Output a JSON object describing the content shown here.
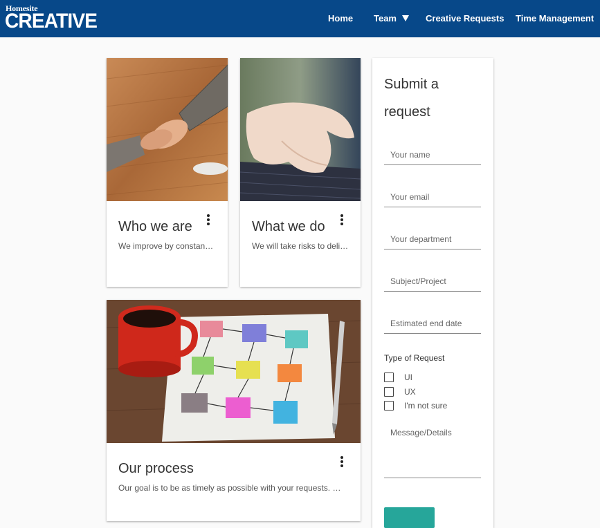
{
  "brand": {
    "small": "Homesite",
    "big": "CREATIVE"
  },
  "nav": {
    "home": "Home",
    "team": "Team",
    "creative_requests": "Creative Requests",
    "time_management": "Time Management"
  },
  "cards": [
    {
      "title": "Who we are",
      "text": "We improve by constantly growing and learning from each other"
    },
    {
      "title": "What we do",
      "text": "We will take risks to deliver better solutions for our customers"
    },
    {
      "title": "Our process",
      "text": "Our goal is to be as timely as possible with your requests. Our team works hard"
    }
  ],
  "form": {
    "title": "Submit a request",
    "name_placeholder": "Your name",
    "email_placeholder": "Your email",
    "department_placeholder": "Your department",
    "subject_placeholder": "Subject/Project",
    "date_placeholder": "Estimated end date",
    "type_label": "Type of Request",
    "options": [
      "UI",
      "UX",
      "I'm not sure"
    ],
    "message_placeholder": "Message/Details"
  },
  "colors": {
    "header": "#074889",
    "submit": "#26a69a"
  }
}
